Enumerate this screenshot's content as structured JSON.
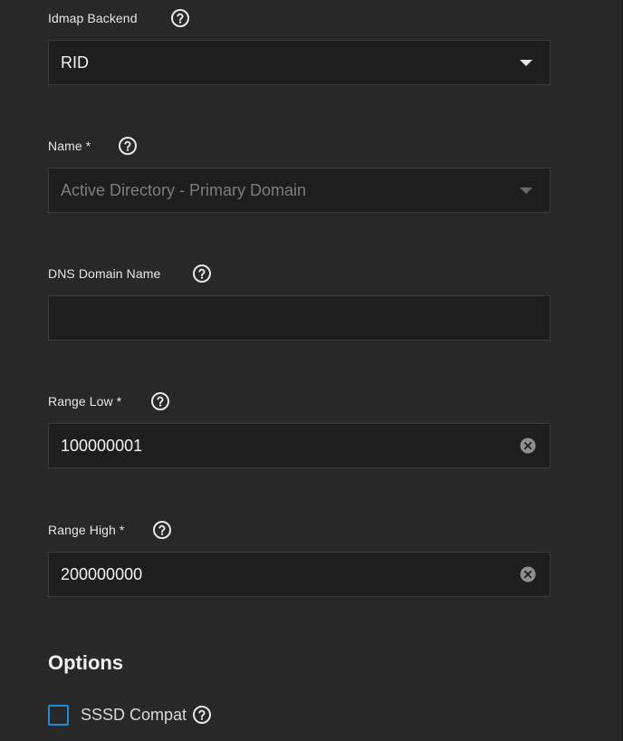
{
  "form": {
    "idmap_backend": {
      "label": "Idmap Backend",
      "value": "RID"
    },
    "name": {
      "label": "Name *",
      "value": "Active Directory - Primary Domain"
    },
    "dns_domain_name": {
      "label": "DNS Domain Name",
      "value": ""
    },
    "range_low": {
      "label": "Range Low *",
      "value": "100000001"
    },
    "range_high": {
      "label": "Range High *",
      "value": "200000000"
    }
  },
  "options": {
    "title": "Options",
    "sssd_compat": {
      "label": "SSSD Compat",
      "checked": false
    }
  },
  "icons": {
    "help": "help-circle-icon",
    "clear": "clear-circle-icon",
    "dropdown": "chevron-down-icon"
  },
  "colors": {
    "background": "#282828",
    "field_background": "#1e1e1e",
    "checkbox_accent": "#1e8ad6"
  }
}
